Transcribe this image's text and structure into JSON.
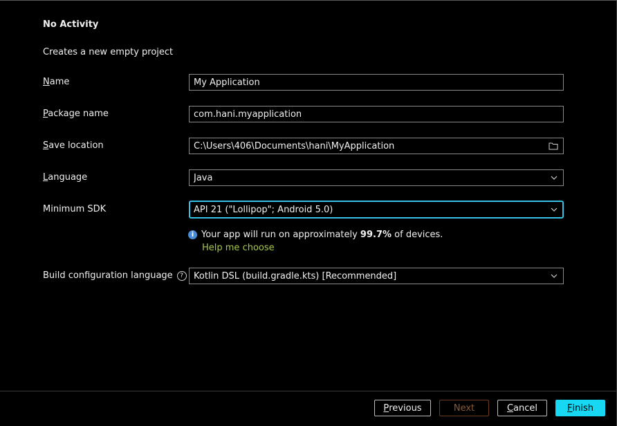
{
  "header": {
    "title": "No Activity",
    "subtitle": "Creates a new empty project"
  },
  "form": {
    "name": {
      "label_first": "N",
      "label_rest": "ame",
      "value": "My Application"
    },
    "package": {
      "label_first": "P",
      "label_rest": "ackage name",
      "value": "com.hani.myapplication"
    },
    "save_location": {
      "label_first": "S",
      "label_rest": "ave location",
      "value": "C:\\Users\\406\\Documents\\hani\\MyApplication"
    },
    "language": {
      "label_first": "L",
      "label_rest": "anguage",
      "value": "Java"
    },
    "min_sdk": {
      "label": "Minimum SDK",
      "value": "API 21 (\"Lollipop\"; Android 5.0)"
    },
    "info": {
      "prefix": "Your app will run on approximately ",
      "percent": "99.7%",
      "suffix": " of devices.",
      "icon": "info-icon"
    },
    "help_link": "Help me choose",
    "build_config": {
      "label": "Build configuration language",
      "value": "Kotlin DSL (build.gradle.kts) [Recommended]",
      "help_icon": "?"
    }
  },
  "footer": {
    "previous": {
      "first": "P",
      "rest": "revious"
    },
    "next": "Next",
    "cancel": {
      "first": "C",
      "rest": "ancel"
    },
    "finish": {
      "first": "F",
      "rest": "inish"
    }
  },
  "colors": {
    "accent": "#17d7f2",
    "focus_border": "#36c2e8",
    "link": "#a7c947",
    "info": "#4a8bd6"
  }
}
